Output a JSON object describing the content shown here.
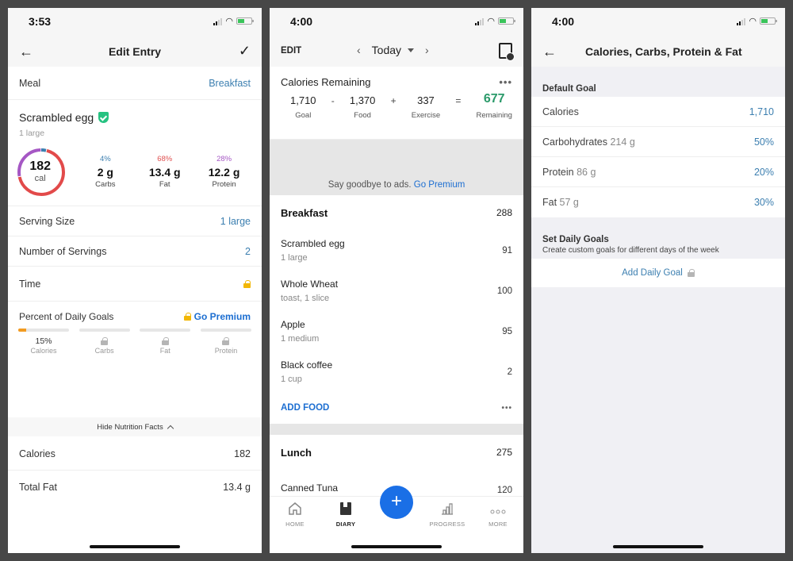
{
  "screen1": {
    "status_time": "3:53",
    "nav_title": "Edit Entry",
    "meal_label": "Meal",
    "meal_value": "Breakfast",
    "food_name": "Scrambled egg",
    "food_serving": "1 large",
    "calories": "182",
    "calories_unit": "cal",
    "macro_ring_split": {
      "carbs_pct": 4,
      "fat_pct": 68,
      "protein_pct": 28
    },
    "macros": [
      {
        "pct": "4%",
        "value": "2 g",
        "label": "Carbs"
      },
      {
        "pct": "68%",
        "value": "13.4 g",
        "label": "Fat"
      },
      {
        "pct": "28%",
        "value": "12.2 g",
        "label": "Protein"
      }
    ],
    "serving_size_label": "Serving Size",
    "serving_size_value": "1 large",
    "servings_label": "Number of Servings",
    "servings_value": "2",
    "time_label": "Time",
    "daily_goals_label": "Percent of Daily Goals",
    "go_premium": "Go Premium",
    "daily_goals": [
      {
        "value": "15%",
        "label": "Calories",
        "fill_pct": 15,
        "locked": false
      },
      {
        "value": "",
        "label": "Carbs",
        "fill_pct": 0,
        "locked": true
      },
      {
        "value": "",
        "label": "Fat",
        "fill_pct": 0,
        "locked": true
      },
      {
        "value": "",
        "label": "Protein",
        "fill_pct": 0,
        "locked": true
      }
    ],
    "hide_nutrition": "Hide Nutrition Facts",
    "nutrition": [
      {
        "label": "Calories",
        "value": "182"
      },
      {
        "label": "Total Fat",
        "value": "13.4 g"
      }
    ]
  },
  "screen2": {
    "status_time": "4:00",
    "edit": "EDIT",
    "date": "Today",
    "cal_remaining_title": "Calories Remaining",
    "equation": {
      "goal": "1,710",
      "goal_label": "Goal",
      "food": "1,370",
      "food_label": "Food",
      "exercise": "337",
      "exercise_label": "Exercise",
      "remaining": "677",
      "remaining_label": "Remaining",
      "op_minus": "-",
      "op_plus": "+",
      "op_eq": "="
    },
    "ad_text": "Say goodbye to ads.",
    "ad_link": "Go Premium",
    "breakfast": {
      "title": "Breakfast",
      "total": "288",
      "items": [
        {
          "name": "Scrambled egg",
          "serving": "1 large",
          "cal": "91"
        },
        {
          "name": "Whole Wheat",
          "serving": "toast, 1 slice",
          "cal": "100"
        },
        {
          "name": "Apple",
          "serving": "1 medium",
          "cal": "95"
        },
        {
          "name": "Black coffee",
          "serving": "1 cup",
          "cal": "2"
        }
      ]
    },
    "add_food": "ADD FOOD",
    "lunch": {
      "title": "Lunch",
      "total": "275",
      "items": [
        {
          "name": "Canned Tuna",
          "serving": "",
          "cal": "120"
        }
      ]
    },
    "tabs": [
      {
        "label": "HOME",
        "icon": "home-icon"
      },
      {
        "label": "DIARY",
        "icon": "diary-icon"
      },
      {
        "label": "PROGRESS",
        "icon": "progress-icon"
      },
      {
        "label": "MORE",
        "icon": "more-icon"
      }
    ],
    "fab": "+"
  },
  "screen3": {
    "status_time": "4:00",
    "nav_title": "Calories, Carbs, Protein & Fat",
    "default_goal": "Default Goal",
    "rows": [
      {
        "label": "Calories",
        "detail": "",
        "value": "1,710"
      },
      {
        "label": "Carbohydrates",
        "detail": "214 g",
        "value": "50%"
      },
      {
        "label": "Protein",
        "detail": "86 g",
        "value": "20%"
      },
      {
        "label": "Fat",
        "detail": "57 g",
        "value": "30%"
      }
    ],
    "set_daily_title": "Set Daily Goals",
    "set_daily_sub": "Create custom goals for different days of the week",
    "add_daily_goal": "Add Daily Goal"
  }
}
